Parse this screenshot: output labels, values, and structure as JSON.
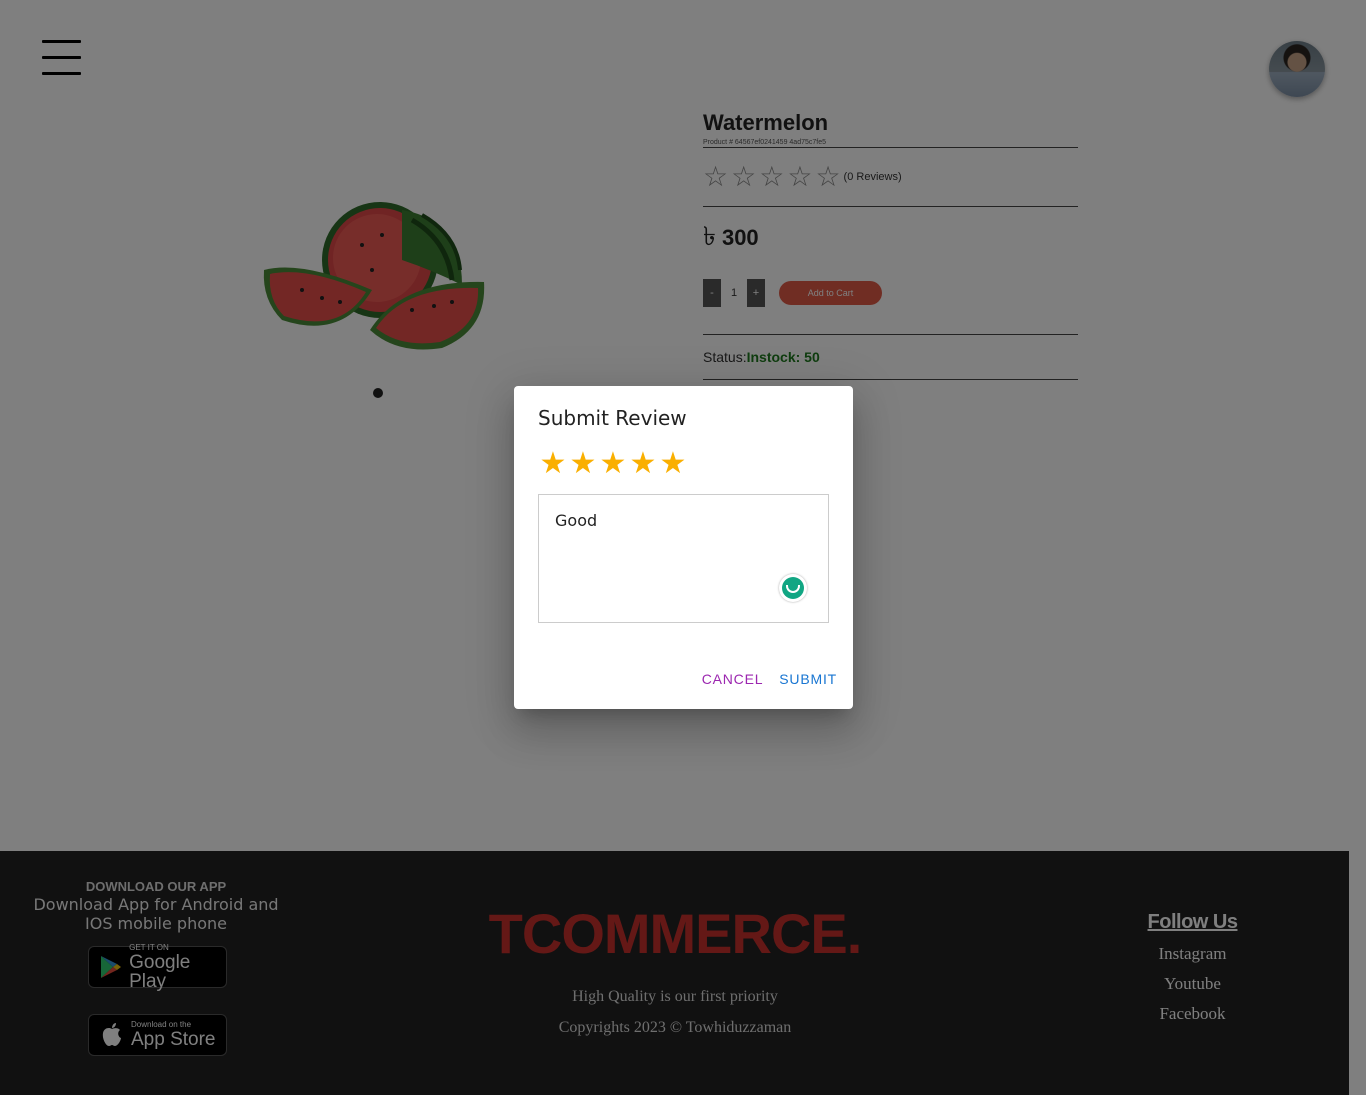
{
  "product": {
    "name": "Watermelon",
    "product_id": "Product # 64567ef0241459 4ad75c7fe5",
    "rating_stars": 0,
    "reviews_label": "(0 Reviews)",
    "currency_symbol": "৳",
    "price": "300",
    "qty_minus": "-",
    "quantity": "1",
    "qty_plus": "+",
    "add_to_cart": "Add to Cart",
    "status_label": "Status:",
    "status_value": "Instock: 50"
  },
  "dialog": {
    "title": "Submit Review",
    "rating_value": 5,
    "review_text": "Good",
    "cancel_label": "CANCEL",
    "submit_label": "SUBMIT"
  },
  "footer": {
    "app_heading": "DOWNLOAD OUR APP",
    "app_desc": "Download App for Android and IOS mobile phone",
    "google_play_small": "GET IT ON",
    "google_play_big": "Google Play",
    "app_store_small": "Download on the",
    "app_store_big": "App Store",
    "brand": "TCOMMERCE.",
    "tagline": "High Quality is our first priority",
    "copyright": "Copyrights 2023 © Towhiduzzaman",
    "follow_title": "Follow Us",
    "social_links": [
      "Instagram",
      "Youtube",
      "Facebook"
    ]
  },
  "colors": {
    "brand_red": "#c8302c",
    "star_gold": "#faaf00",
    "status_green": "#1f7a1f",
    "cancel_purple": "#9c27b0",
    "submit_blue": "#1976d2",
    "add_cart_red": "#e05a47"
  },
  "icons": {
    "menu": "hamburger-icon",
    "avatar": "user-avatar",
    "google_play": "google-play-icon",
    "app_store": "apple-icon",
    "grammar": "grammarly-icon"
  }
}
